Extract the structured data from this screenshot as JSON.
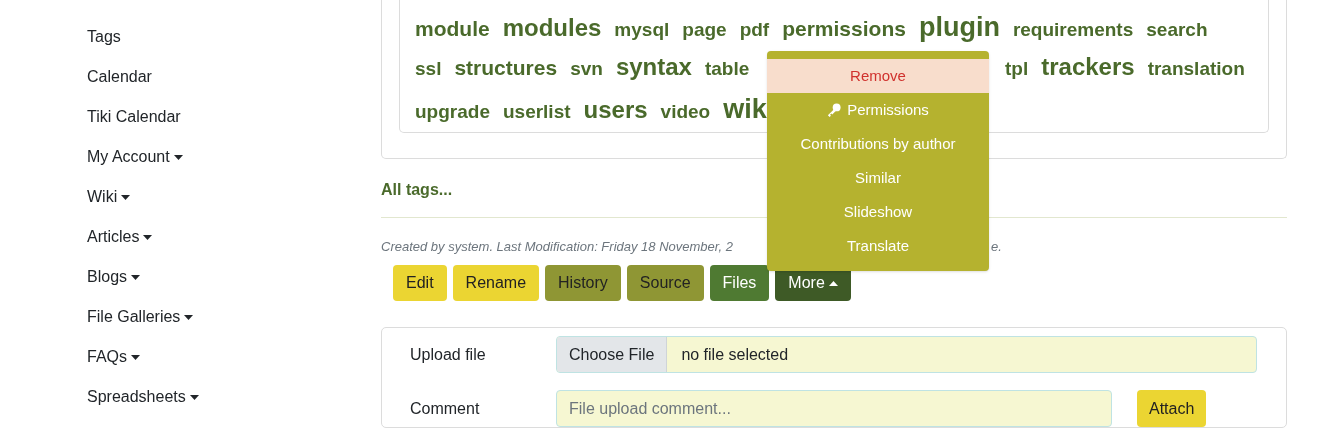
{
  "sidebar": {
    "items": [
      {
        "label": "Tags",
        "has_menu": false
      },
      {
        "label": "Calendar",
        "has_menu": false
      },
      {
        "label": "Tiki Calendar",
        "has_menu": false
      },
      {
        "label": "My Account",
        "has_menu": true
      },
      {
        "label": "Wiki",
        "has_menu": true
      },
      {
        "label": "Articles",
        "has_menu": true
      },
      {
        "label": "Blogs",
        "has_menu": true
      },
      {
        "label": "File Galleries",
        "has_menu": true
      },
      {
        "label": "FAQs",
        "has_menu": true
      },
      {
        "label": "Spreadsheets",
        "has_menu": true
      }
    ]
  },
  "tag_cloud": {
    "rows": [
      {
        "tags": [
          {
            "label": "module",
            "kind": "medium"
          },
          {
            "label": "modules",
            "kind": "large"
          },
          {
            "label": "mysql",
            "kind": "small"
          },
          {
            "label": "page",
            "kind": "small"
          },
          {
            "label": "pdf",
            "kind": "small"
          },
          {
            "label": "permissions",
            "kind": "medium"
          },
          {
            "label": "plugin",
            "kind": "xlarge"
          },
          {
            "label": "requirements",
            "kind": "small"
          },
          {
            "label": "search",
            "kind": "small"
          }
        ]
      },
      {
        "tags": [
          {
            "label": "ssl",
            "kind": "small"
          },
          {
            "label": "structures",
            "kind": "medium"
          },
          {
            "label": "svn",
            "kind": "small"
          },
          {
            "label": "syntax",
            "kind": "large"
          },
          {
            "label": "table",
            "kind": "small"
          }
        ],
        "after_menu": [
          {
            "label": "tpl",
            "kind": "small"
          },
          {
            "label": "trackers",
            "kind": "large"
          },
          {
            "label": "translation",
            "kind": "small"
          }
        ]
      },
      {
        "tags": [
          {
            "label": "upgrade",
            "kind": "small"
          },
          {
            "label": "userlist",
            "kind": "small"
          },
          {
            "label": "users",
            "kind": "large"
          },
          {
            "label": "video",
            "kind": "small"
          },
          {
            "label": "wik",
            "kind": "xlarge"
          }
        ]
      }
    ]
  },
  "all_tags_link": "All tags...",
  "meta": {
    "before_menu": "Created by *system*. Last Modification: Friday 18 November, 2",
    "after_menu": "e."
  },
  "actions": [
    {
      "label": "Edit",
      "kind": "warning"
    },
    {
      "label": "Rename",
      "kind": "warning"
    },
    {
      "label": "History",
      "kind": "secondary"
    },
    {
      "label": "Source",
      "kind": "secondary"
    },
    {
      "label": "Files",
      "kind": "success"
    },
    {
      "label": "More",
      "kind": "dark",
      "caret": true
    }
  ],
  "more_menu": {
    "items": [
      {
        "label": "Remove",
        "kind": "danger",
        "highlighted": true
      },
      {
        "label": "Permissions",
        "kind": "key",
        "highlighted": false
      },
      {
        "label": "Contributions by author",
        "kind": "plain",
        "highlighted": false
      },
      {
        "label": "Similar",
        "kind": "plain",
        "highlighted": false
      },
      {
        "label": "Slideshow",
        "kind": "plain",
        "highlighted": false
      },
      {
        "label": "Translate",
        "kind": "plain",
        "highlighted": false
      }
    ]
  },
  "upload": {
    "file_label": "Upload file",
    "choose_button": "Choose File",
    "file_status": "no file selected",
    "comment_label": "Comment",
    "comment_placeholder": "File upload comment...",
    "attach_button": "Attach"
  }
}
